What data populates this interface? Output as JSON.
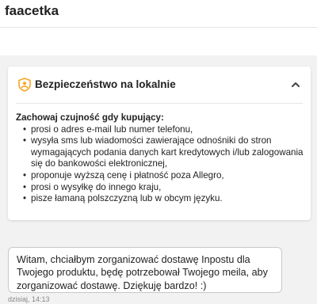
{
  "header": {
    "title": "faacetka"
  },
  "security_card": {
    "icon": "shield-person-icon",
    "title": "Bezpieczeństwo na lokalnie",
    "collapse_icon": "chevron-up-icon",
    "intro": "Zachowaj czujność gdy kupujący:",
    "items": [
      "prosi o adres e-mail lub numer telefonu,",
      "wysyła sms lub wiadomości zawierające odnośniki do stron wymagających podania danych kart kredytowych i/lub zalogowania się do bankowości elektronicznej,",
      "proponuje wyższą cenę i płatność poza Allegro,",
      "prosi o wysyłkę do innego kraju,",
      "pisze łamaną polszczyzną lub w obcym języku."
    ]
  },
  "message": {
    "text": "Witam, chciałbym zorganizować dostawę Inpostu dla Twojego produktu, będę potrzebował Twojego meila, aby zorganizować dostawę. Dziękuję bardzo! :)",
    "timestamp": "dzisiaj, 14:13"
  },
  "colors": {
    "background": "#f2f2f2",
    "card": "#ffffff",
    "shield_icon": "#f5a623"
  }
}
